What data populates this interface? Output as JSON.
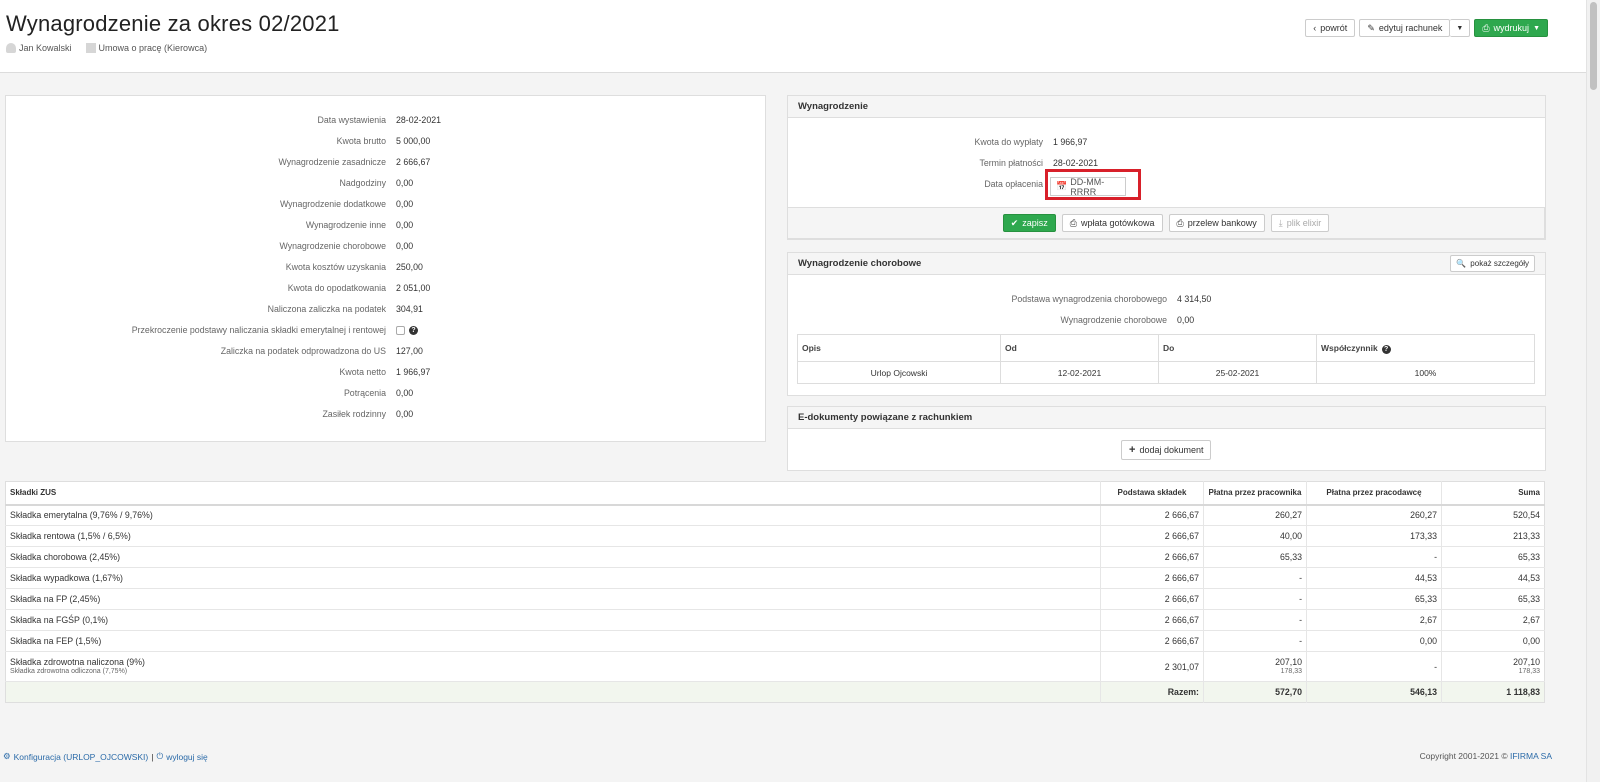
{
  "header": {
    "title": "Wynagrodzenie za okres 02/2021",
    "employee": "Jan Kowalski",
    "contract": "Umowa o pracę (Kierowca)",
    "btn_back": "powrót",
    "btn_edit": "edytuj rachunek",
    "btn_print": "wydrukuj"
  },
  "left": {
    "rows": [
      {
        "label": "Data wystawienia",
        "value": "28-02-2021"
      },
      {
        "label": "Kwota brutto",
        "value": "5 000,00"
      },
      {
        "label": "Wynagrodzenie zasadnicze",
        "value": "2 666,67"
      },
      {
        "label": "Nadgodziny",
        "value": "0,00"
      },
      {
        "label": "Wynagrodzenie dodatkowe",
        "value": "0,00"
      },
      {
        "label": "Wynagrodzenie inne",
        "value": "0,00"
      },
      {
        "label": "Wynagrodzenie chorobowe",
        "value": "0,00"
      },
      {
        "label": "Kwota kosztów uzyskania",
        "value": "250,00"
      },
      {
        "label": "Kwota do opodatkowania",
        "value": "2 051,00"
      },
      {
        "label": "Naliczona zaliczka na podatek",
        "value": "304,91"
      },
      {
        "label": "Przekroczenie podstawy naliczania składki emerytalnej i rentowej",
        "value": ""
      },
      {
        "label": "Zaliczka na podatek odprowadzona do US",
        "value": "127,00"
      },
      {
        "label": "Kwota netto",
        "value": "1 966,97"
      },
      {
        "label": "Potrącenia",
        "value": "0,00"
      },
      {
        "label": "Zasiłek rodzinny",
        "value": "0,00"
      }
    ]
  },
  "salary": {
    "title": "Wynagrodzenie",
    "rows": [
      {
        "label": "Kwota do wypłaty",
        "value": "1 966,97"
      },
      {
        "label": "Termin płatności",
        "value": "28-02-2021"
      },
      {
        "label": "Data opłacenia",
        "value": ""
      }
    ],
    "date_placeholder": "DD-MM-RRRR",
    "btn_save": "zapisz",
    "btn_cash": "wpłata gotówkowa",
    "btn_transfer": "przelew bankowy",
    "btn_elixir": "plik elixir"
  },
  "sick": {
    "title": "Wynagrodzenie chorobowe",
    "btn_details": "pokaż szczegóły",
    "rows": [
      {
        "label": "Podstawa wynagrodzenia chorobowego",
        "value": "4 314,50"
      },
      {
        "label": "Wynagrodzenie chorobowe",
        "value": "0,00"
      }
    ],
    "table": {
      "headers": [
        "Opis",
        "Od",
        "Do",
        "Współczynnik"
      ],
      "row": [
        "Urlop Ojcowski",
        "12-02-2021",
        "25-02-2021",
        "100%"
      ]
    }
  },
  "edocs": {
    "title": "E-dokumenty powiązane z rachunkiem",
    "btn_add": "dodaj dokument"
  },
  "zus": {
    "headers": [
      "Składki ZUS",
      "Podstawa składek",
      "Płatna przez pracownika",
      "Płatna przez pracodawcę",
      "Suma"
    ],
    "rows": [
      [
        "Składka emerytalna (9,76% / 9,76%)",
        "2 666,67",
        "260,27",
        "260,27",
        "520,54"
      ],
      [
        "Składka rentowa (1,5% / 6,5%)",
        "2 666,67",
        "40,00",
        "173,33",
        "213,33"
      ],
      [
        "Składka chorobowa (2,45%)",
        "2 666,67",
        "65,33",
        "-",
        "65,33"
      ],
      [
        "Składka wypadkowa (1,67%)",
        "2 666,67",
        "-",
        "44,53",
        "44,53"
      ],
      [
        "Składka na FP (2,45%)",
        "2 666,67",
        "-",
        "65,33",
        "65,33"
      ],
      [
        "Składka na FGŚP (0,1%)",
        "2 666,67",
        "-",
        "2,67",
        "2,67"
      ],
      [
        "Składka na FEP (1,5%)",
        "2 666,67",
        "-",
        "0,00",
        "0,00"
      ]
    ],
    "health": {
      "label": "Składka zdrowotna naliczona (9%)",
      "sublabel": "Składka zdrowotna odliczona (7,75%)",
      "base": "2 301,07",
      "employee": "207,10",
      "employee_sub": "178,33",
      "employer": "-",
      "sum": "207,10",
      "sum_sub": "178,33"
    },
    "total": {
      "label": "Razem:",
      "employee": "572,70",
      "employer": "546,13",
      "sum": "1 118,83"
    }
  },
  "footer": {
    "config": "Konfiguracja (URLOP_OJCOWSKI)",
    "sep": "|",
    "logout": "wyloguj się",
    "copyright": "Copyright 2001-2021 ©",
    "brand": "IFIRMA SA"
  }
}
